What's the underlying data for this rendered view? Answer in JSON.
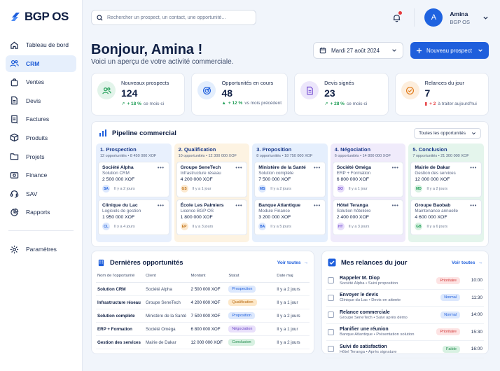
{
  "brand": {
    "name": "BGP OS"
  },
  "sidebar": {
    "items": [
      {
        "label": "Tableau de bord",
        "icon": "home-icon"
      },
      {
        "label": "CRM",
        "icon": "users-icon"
      },
      {
        "label": "Ventes",
        "icon": "shopping-bag-icon"
      },
      {
        "label": "Devis",
        "icon": "document-icon"
      },
      {
        "label": "Factures",
        "icon": "invoice-icon"
      },
      {
        "label": "Produits",
        "icon": "box-icon"
      },
      {
        "label": "Projets",
        "icon": "folder-icon"
      },
      {
        "label": "Finance",
        "icon": "finance-icon"
      },
      {
        "label": "SAV",
        "icon": "headset-icon"
      },
      {
        "label": "Rapports",
        "icon": "pie-chart-icon"
      }
    ],
    "settings": "Paramètres"
  },
  "search": {
    "placeholder": "Rechercher un prospect, un contact, une opportunité..."
  },
  "user": {
    "name": "Amina",
    "org": "BGP OS",
    "initial": "A"
  },
  "greeting": {
    "title": "Bonjour, Amina !",
    "subtitle": "Voici un aperçu de votre activité commerciale."
  },
  "date": "Mardi 27 août 2024",
  "new_button": "Nouveau prospect",
  "kpis": [
    {
      "title": "Nouveaux prospects",
      "value": "124",
      "delta": "+ 18 %",
      "note": "ce mois-ci",
      "trend": "up"
    },
    {
      "title": "Opportunités en cours",
      "value": "48",
      "delta": "+ 12 %",
      "note": "vs mois précédent",
      "trend": "up"
    },
    {
      "title": "Devis signés",
      "value": "23",
      "delta": "+ 28 %",
      "note": "ce mois-ci",
      "trend": "up"
    },
    {
      "title": "Relances du jour",
      "value": "7",
      "delta": "+ 2",
      "note": "à traiter aujourd'hui",
      "trend": "down"
    }
  ],
  "pipeline": {
    "title": "Pipeline commercial",
    "filter": "Toutes les opportunités",
    "columns": [
      {
        "title": "1. Prospection",
        "sub": "12 opportunités • 8 450 000 XOF",
        "cards": [
          {
            "name": "Société Alpha",
            "desc": "Solution CRM",
            "amount": "2 500 000 XOF",
            "initials": "SA",
            "time": "Il y a 2 jours"
          },
          {
            "name": "Clinique du Lac",
            "desc": "Logiciels de gestion",
            "amount": "1 950 000 XOF",
            "initials": "CL",
            "time": "Il y a 4 jours"
          }
        ]
      },
      {
        "title": "2. Qualification",
        "sub": "10 opportunités • 12 300 000 XOF",
        "cards": [
          {
            "name": "Groupe SeneTech",
            "desc": "Infrastructure réseau",
            "amount": "4 200 000 XOF",
            "initials": "GS",
            "time": "Il y a 1 jour"
          },
          {
            "name": "École Les Palmiers",
            "desc": "Licence BGP OS",
            "amount": "1 800 000 XOF",
            "initials": "EP",
            "time": "Il y a 3 jours"
          }
        ]
      },
      {
        "title": "3. Proposition",
        "sub": "8 opportunités • 18 750 000 XOF",
        "cards": [
          {
            "name": "Ministère de la Santé",
            "desc": "Solution complète",
            "amount": "7 500 000 XOF",
            "initials": "MS",
            "time": "Il y a 2 jours"
          },
          {
            "name": "Banque Atlantique",
            "desc": "Module Finance",
            "amount": "3 200 000 XOF",
            "initials": "BA",
            "time": "Il y a 5 jours"
          }
        ]
      },
      {
        "title": "4. Négociation",
        "sub": "6 opportunités • 14 800 000 XOF",
        "cards": [
          {
            "name": "Société Oméga",
            "desc": "ERP + Formation",
            "amount": "6 800 000 XOF",
            "initials": "SO",
            "time": "Il y a 1 jour"
          },
          {
            "name": "Hôtel Teranga",
            "desc": "Solution hôtelière",
            "amount": "2 400 000 XOF",
            "initials": "HT",
            "time": "Il y a 3 jours"
          }
        ]
      },
      {
        "title": "5. Conclusion",
        "sub": "7 opportunités • 21 300 000 XOF",
        "cards": [
          {
            "name": "Mairie de Dakar",
            "desc": "Gestion des services",
            "amount": "12 000 000 XOF",
            "initials": "MD",
            "time": "Il y a 2 jours"
          },
          {
            "name": "Groupe Baobab",
            "desc": "Maintenance annuelle",
            "amount": "4 600 000 XOF",
            "initials": "GB",
            "time": "Il y a 6 jours"
          }
        ]
      }
    ]
  },
  "opportunities": {
    "title": "Dernières opportunités",
    "link": "Voir toutes",
    "headers": [
      "Nom de l'opportunité",
      "Client",
      "Montant",
      "Statut",
      "Date maj"
    ],
    "rows": [
      {
        "name": "Solution CRM",
        "client": "Société Alpha",
        "amount": "2 500 000 XOF",
        "status": "Prospection",
        "date": "Il y a 2 jours"
      },
      {
        "name": "Infrastructure réseau",
        "client": "Groupe SeneTech",
        "amount": "4 200 000 XOF",
        "status": "Qualification",
        "date": "Il y a 1 jour"
      },
      {
        "name": "Solution complète",
        "client": "Ministère de la Santé",
        "amount": "7 500 000 XOF",
        "status": "Proposition",
        "date": "Il y a 2 jours"
      },
      {
        "name": "ERP + Formation",
        "client": "Société Oméga",
        "amount": "6 800 000 XOF",
        "status": "Négociation",
        "date": "Il y a 1 jour"
      },
      {
        "name": "Gestion des services",
        "client": "Mairie de Dakar",
        "amount": "12 000 000 XOF",
        "status": "Conclusion",
        "date": "Il y a 2 jours"
      }
    ]
  },
  "relances": {
    "title": "Mes relances du jour",
    "link": "Voir toutes",
    "items": [
      {
        "title": "Rappeler M. Diop",
        "sub": "Société Alpha • Suivi proposition",
        "priority": "Prioritaire",
        "time": "10:00"
      },
      {
        "title": "Envoyer le devis",
        "sub": "Clinique du Lac • Devis en attente",
        "priority": "Normal",
        "time": "11:30"
      },
      {
        "title": "Relance commerciale",
        "sub": "Groupe SeneTech • Suivi après démo",
        "priority": "Normal",
        "time": "14:00"
      },
      {
        "title": "Planifier une réunion",
        "sub": "Banque Atlantique • Présentation solution",
        "priority": "Prioritaire",
        "time": "15:30"
      },
      {
        "title": "Suivi de satisfaction",
        "sub": "Hôtel Teranga • Après signature",
        "priority": "Faible",
        "time": "16:00"
      }
    ]
  },
  "colors": {
    "accent": "#1f5fdc",
    "prospection": "#e6efff",
    "qualification": "#fdf1de",
    "proposition": "#e3efff",
    "negociation": "#efe9fb",
    "conclusion": "#e3f5ec"
  }
}
